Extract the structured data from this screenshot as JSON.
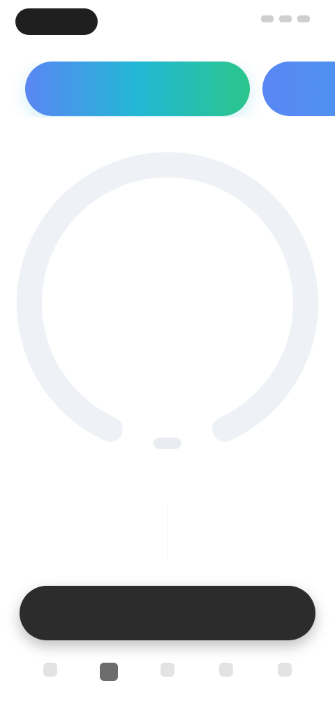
{
  "status_bar": {
    "time": "",
    "icons": [
      "signal-icon",
      "wifi-icon",
      "battery-icon"
    ]
  },
  "cards": [
    {
      "name": "active-mode-card",
      "label": "",
      "gradient": [
        "#5a86f3",
        "#22b8d6",
        "#2bc58b"
      ]
    },
    {
      "name": "next-mode-card",
      "label": "",
      "gradient": [
        "#5a86f3",
        "#4b95f0"
      ]
    }
  ],
  "timer": {
    "subtitle": "",
    "time": "",
    "ring_progress": 0,
    "ring_color": "#e9ecf1"
  },
  "stats": {
    "left": {
      "value": ""
    },
    "right": {
      "value": ""
    }
  },
  "cta": {
    "label": ""
  },
  "tabbar": {
    "tabs": [
      "tab-1",
      "tab-2",
      "tab-3",
      "tab-4",
      "tab-5"
    ],
    "active_index": 1
  },
  "colors": {
    "accent_blue": "#5a86f3",
    "accent_teal": "#22b8d6",
    "accent_green": "#2bc58b",
    "dark": "#2c2c2c"
  }
}
